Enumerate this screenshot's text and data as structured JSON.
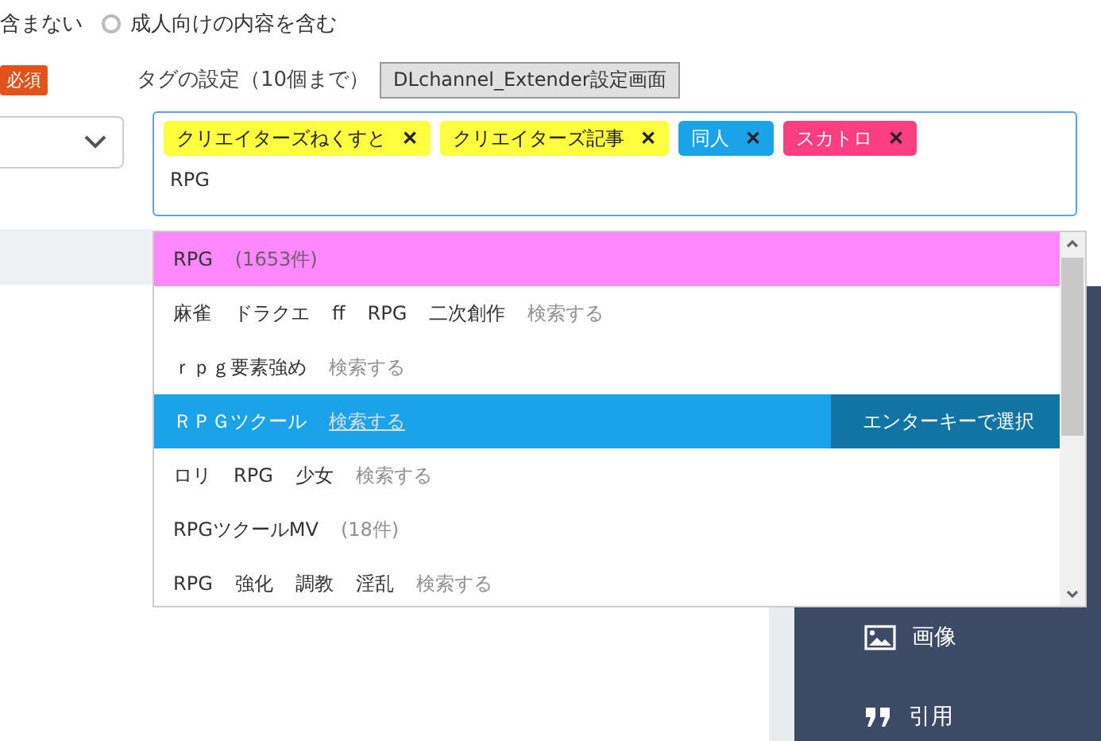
{
  "rating": {
    "options": [
      {
        "label": "含まない"
      },
      {
        "label": "成人向けの内容を含む",
        "selected": false
      }
    ]
  },
  "category": {
    "badge": "必須"
  },
  "tags": {
    "label": "タグの設定（10個まで）",
    "settings_button": "DLchannel_Extender設定画面",
    "chips": [
      {
        "label": "クリエイターズねくすと",
        "color": "#ffff40",
        "remove": "✕"
      },
      {
        "label": "クリエイターズ記事",
        "color": "#ffff40",
        "remove": "✕"
      },
      {
        "label": "同人",
        "color": "#1aa3e8",
        "remove": "✕"
      },
      {
        "label": "スカトロ",
        "color": "#ff3d80",
        "remove": "✕"
      }
    ],
    "input": "RPG",
    "suggestions": [
      {
        "kind": "exact",
        "words": [
          "RPG"
        ],
        "note": "(1653件)",
        "selected": false
      },
      {
        "kind": "search",
        "words": [
          "麻雀",
          "ドラクエ",
          "ff",
          "RPG",
          "二次創作"
        ],
        "note": "検索する",
        "selected": false
      },
      {
        "kind": "search",
        "words": [
          "ｒｐｇ要素強め"
        ],
        "note": "検索する",
        "selected": false
      },
      {
        "kind": "search",
        "words": [
          "ＲＰＧツクール"
        ],
        "note": "検索する",
        "selected": true
      },
      {
        "kind": "search",
        "words": [
          "ロリ",
          "RPG",
          "少女"
        ],
        "note": "検索する",
        "selected": false
      },
      {
        "kind": "count",
        "words": [
          "RPGツクールMV"
        ],
        "note": "(18件)",
        "selected": false
      },
      {
        "kind": "search",
        "words": [
          "RPG",
          "強化",
          "調教",
          "淫乱"
        ],
        "note": "検索する",
        "selected": false
      }
    ],
    "enter_hint": "エンターキーで選択"
  },
  "sidebar": {
    "items": [
      {
        "label": "画像",
        "kind": "image"
      },
      {
        "label": "引用",
        "kind": "quote"
      }
    ]
  }
}
